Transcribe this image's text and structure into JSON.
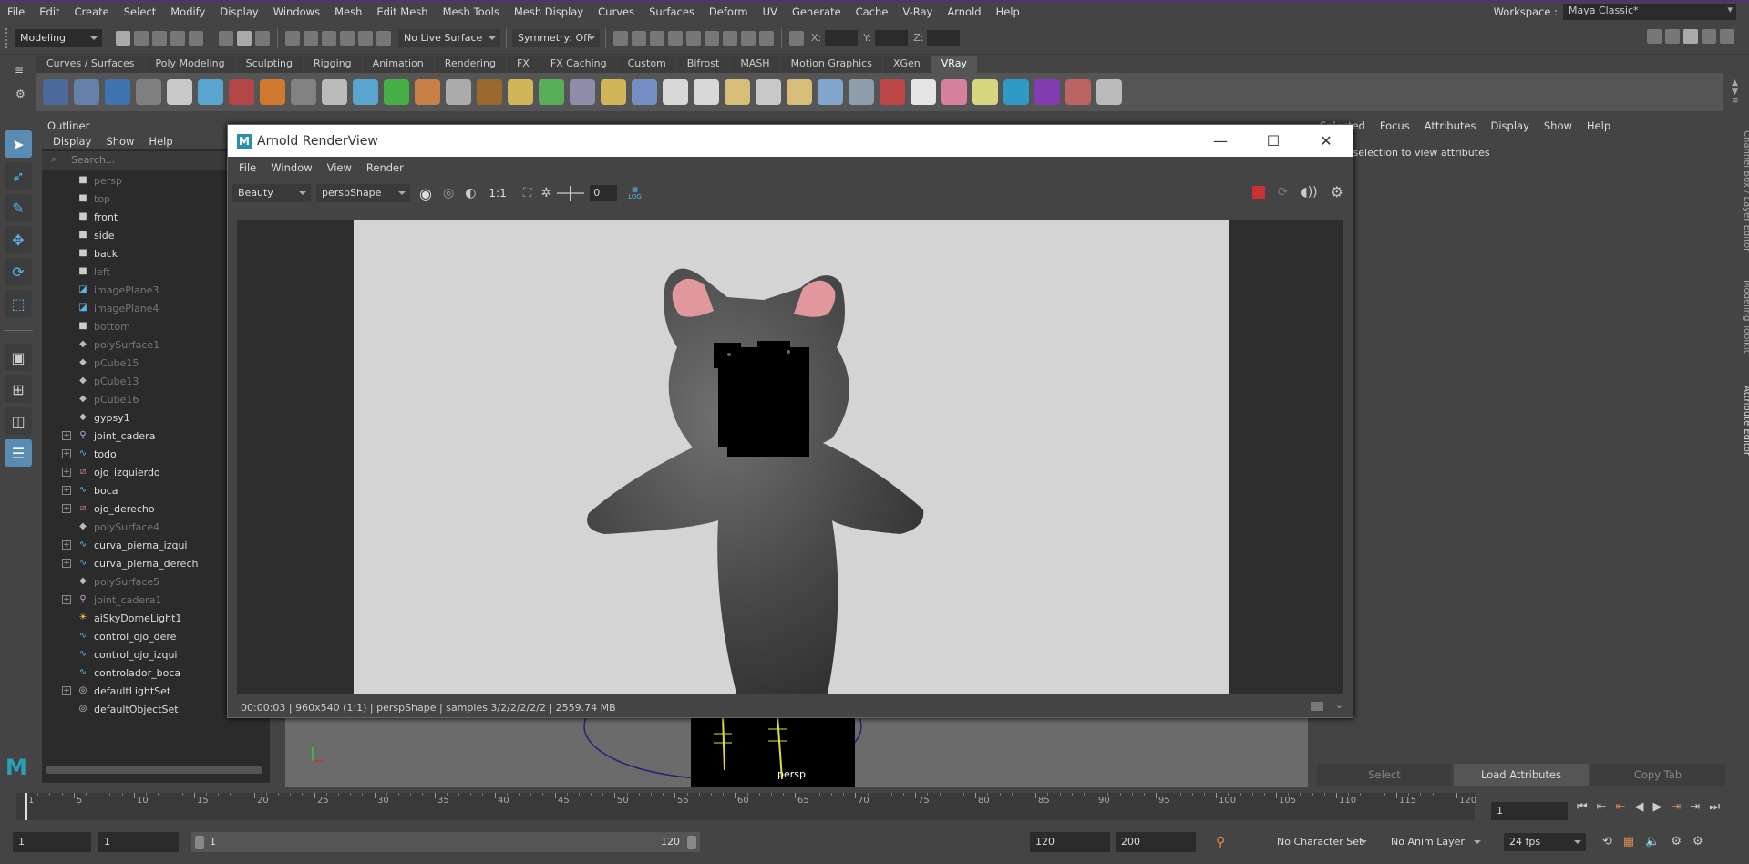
{
  "menubar": {
    "items": [
      "File",
      "Edit",
      "Create",
      "Select",
      "Modify",
      "Display",
      "Windows",
      "Mesh",
      "Edit Mesh",
      "Mesh Tools",
      "Mesh Display",
      "Curves",
      "Surfaces",
      "Deform",
      "UV",
      "Generate",
      "Cache",
      "V-Ray",
      "Arnold",
      "Help"
    ],
    "workspace_label": "Workspace :",
    "workspace_value": "Maya Classic*"
  },
  "statusline": {
    "mode": "Modeling",
    "live_surface": "No Live Surface",
    "symmetry": "Symmetry: Off",
    "x_label": "X:",
    "y_label": "Y:",
    "z_label": "Z:"
  },
  "shelf": {
    "tabs": [
      "Curves / Surfaces",
      "Poly Modeling",
      "Sculpting",
      "Rigging",
      "Animation",
      "Rendering",
      "FX",
      "FX Caching",
      "Custom",
      "Bifrost",
      "MASH",
      "Motion Graphics",
      "XGen",
      "VRay"
    ],
    "active_tab": "VRay"
  },
  "outliner": {
    "title": "Outliner",
    "menu": [
      "Display",
      "Show",
      "Help"
    ],
    "search_placeholder": "Search...",
    "items": [
      {
        "label": "persp",
        "icon": "camera-icon",
        "dim": true,
        "expand": false
      },
      {
        "label": "top",
        "icon": "camera-icon",
        "dim": true,
        "expand": false
      },
      {
        "label": "front",
        "icon": "camera-icon",
        "dim": false,
        "expand": false
      },
      {
        "label": "side",
        "icon": "camera-icon",
        "dim": false,
        "expand": false
      },
      {
        "label": "back",
        "icon": "camera-icon",
        "dim": false,
        "expand": false
      },
      {
        "label": "left",
        "icon": "camera-icon",
        "dim": true,
        "expand": false
      },
      {
        "label": "imagePlane3",
        "icon": "imageplane-icon",
        "dim": true,
        "expand": false
      },
      {
        "label": "imagePlane4",
        "icon": "imageplane-icon",
        "dim": true,
        "expand": false
      },
      {
        "label": "bottom",
        "icon": "camera-icon",
        "dim": true,
        "expand": false
      },
      {
        "label": "polySurface1",
        "icon": "mesh-icon",
        "dim": true,
        "expand": false
      },
      {
        "label": "pCube15",
        "icon": "mesh-icon",
        "dim": true,
        "expand": false
      },
      {
        "label": "pCube13",
        "icon": "mesh-icon",
        "dim": true,
        "expand": false
      },
      {
        "label": "pCube16",
        "icon": "mesh-icon",
        "dim": true,
        "expand": false
      },
      {
        "label": "gypsy1",
        "icon": "mesh-icon",
        "dim": false,
        "expand": false
      },
      {
        "label": "joint_cadera",
        "icon": "joint-icon",
        "dim": false,
        "expand": true
      },
      {
        "label": "todo",
        "icon": "curve-icon",
        "dim": false,
        "expand": true
      },
      {
        "label": "ojo_izquierdo",
        "icon": "cluster-icon",
        "dim": false,
        "expand": true
      },
      {
        "label": "boca",
        "icon": "curve-icon",
        "dim": false,
        "expand": true
      },
      {
        "label": "ojo_derecho",
        "icon": "cluster-icon",
        "dim": false,
        "expand": true
      },
      {
        "label": "polySurface4",
        "icon": "mesh-icon",
        "dim": true,
        "expand": false
      },
      {
        "label": "curva_pierna_izqui",
        "icon": "curve-icon",
        "dim": false,
        "expand": true
      },
      {
        "label": "curva_pierna_derech",
        "icon": "curve-icon",
        "dim": false,
        "expand": true
      },
      {
        "label": "polySurface5",
        "icon": "mesh-icon",
        "dim": true,
        "expand": false
      },
      {
        "label": "joint_cadera1",
        "icon": "joint-icon",
        "dim": true,
        "expand": true
      },
      {
        "label": "aiSkyDomeLight1",
        "icon": "light-icon",
        "dim": false,
        "expand": false
      },
      {
        "label": "control_ojo_dere",
        "icon": "curve-icon",
        "dim": false,
        "expand": false
      },
      {
        "label": "control_ojo_izqui",
        "icon": "curve-icon",
        "dim": false,
        "expand": false
      },
      {
        "label": "controlador_boca",
        "icon": "curve-icon",
        "dim": false,
        "expand": false
      },
      {
        "label": "defaultLightSet",
        "icon": "set-icon",
        "dim": false,
        "expand": true
      },
      {
        "label": "defaultObjectSet",
        "icon": "set-icon",
        "dim": false,
        "expand": false
      }
    ]
  },
  "render_view": {
    "title": "Arnold RenderView",
    "menu": [
      "File",
      "Window",
      "View",
      "Render"
    ],
    "aov": "Beauty",
    "camera": "perspShape",
    "ratio": "1:1",
    "exposure": "0",
    "log": "LOG",
    "status": "00:00:03 | 960x540 (1:1) | perspShape  | samples 3/2/2/2/2/2 | 2559.74 MB"
  },
  "viewport": {
    "camera_label": "persp"
  },
  "attribute_editor": {
    "menu": [
      "Selected",
      "Focus",
      "Attributes",
      "Display",
      "Show",
      "Help"
    ],
    "message": "ce a selection to view attributes",
    "buttons": [
      "Select",
      "Load Attributes",
      "Copy Tab"
    ]
  },
  "vertical_tabs": [
    "Channel Box / Layer Editor",
    "Modeling Toolkit",
    "Attribute Editor"
  ],
  "timeline": {
    "ticks": [
      "1",
      "5",
      "10",
      "15",
      "20",
      "25",
      "30",
      "35",
      "40",
      "45",
      "50",
      "55",
      "60",
      "65",
      "70",
      "75",
      "80",
      "85",
      "90",
      "95",
      "100",
      "105",
      "110",
      "115",
      "120"
    ],
    "current_frame": "1"
  },
  "range": {
    "start": "1",
    "start_inner": "1",
    "slider_start": "1",
    "slider_end": "120",
    "end_inner": "120",
    "end": "200",
    "character_set": "No Character Set",
    "anim_layer": "No Anim Layer",
    "fps": "24 fps"
  }
}
